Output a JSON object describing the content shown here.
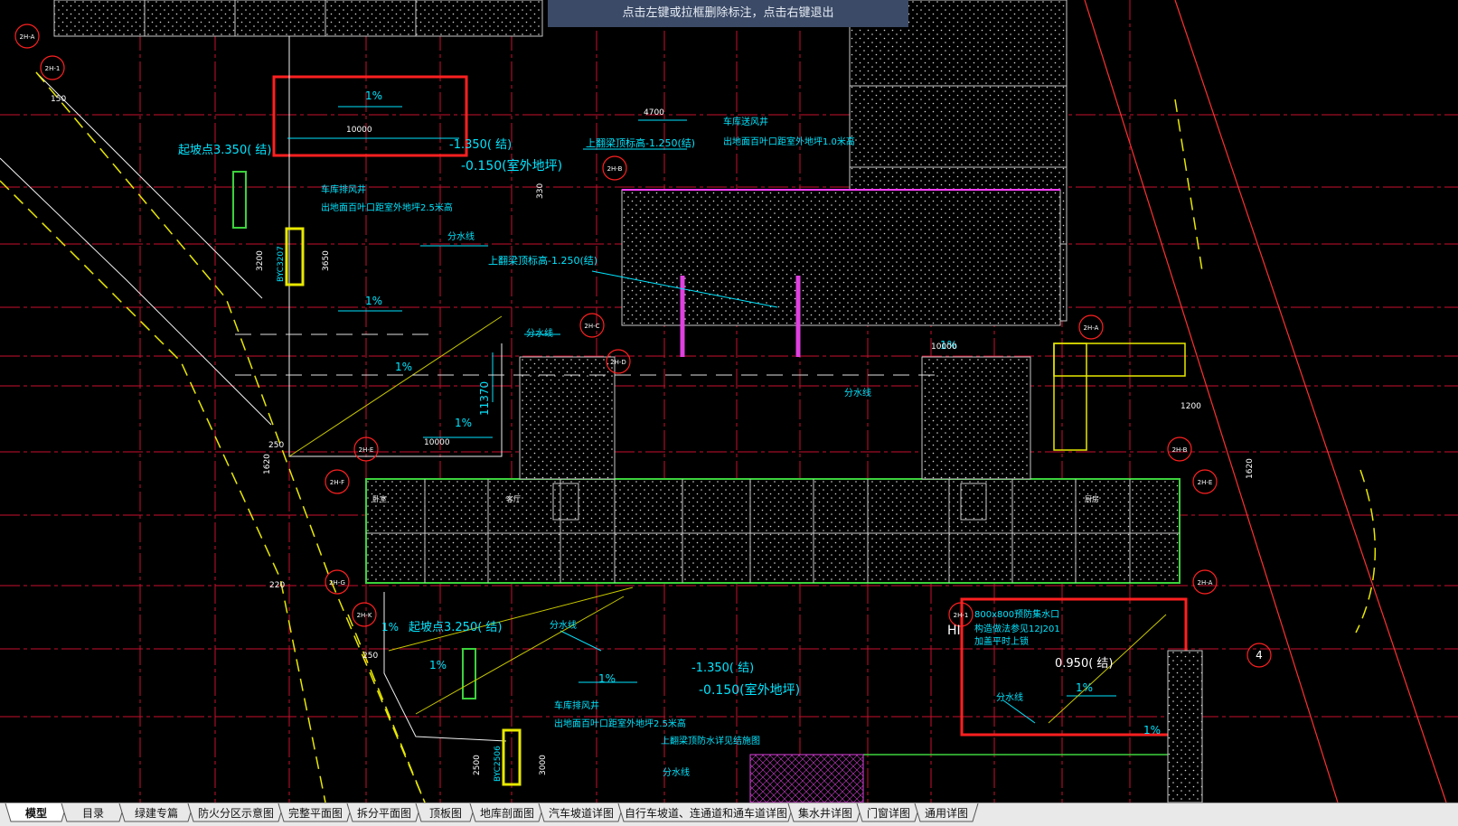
{
  "app": {
    "mode": "CAD drawing viewer"
  },
  "tooltip": {
    "text": "点击左键或拉框删除标注，点击右键退出"
  },
  "colors": {
    "background": "#000000",
    "grid_red": "#c8102e",
    "cyan": "#00e5ff",
    "yellow": "#e8e800",
    "green": "#3cd23c",
    "magenta": "#e040e0",
    "white": "#f0f0f0",
    "tooltip_bg": "#3b4a66"
  },
  "tabs": [
    {
      "label": "模型",
      "active": true
    },
    {
      "label": "目录",
      "active": false
    },
    {
      "label": "绿建专篇",
      "active": false
    },
    {
      "label": "防火分区示意图",
      "active": false
    },
    {
      "label": "完整平面图",
      "active": false
    },
    {
      "label": "拆分平面图",
      "active": false
    },
    {
      "label": "顶板图",
      "active": false
    },
    {
      "label": "地库剖面图",
      "active": false
    },
    {
      "label": "汽车坡道详图",
      "active": false
    },
    {
      "label": "自行车坡道、连通道和通车道详图",
      "active": false
    },
    {
      "label": "集水井详图",
      "active": false
    },
    {
      "label": "门窗详图",
      "active": false
    },
    {
      "label": "通用详图",
      "active": false
    }
  ],
  "annotations": {
    "slope_1pct": "1%",
    "dim_10000": "10000",
    "dim_4700": "4700",
    "dim_11370": "11370",
    "dim_1200": "1200",
    "dim_1620": "1620",
    "dim_3200": "3200",
    "dim_3650": "3650",
    "dim_3000": "3000",
    "dim_2500": "2500",
    "dim_330": "330",
    "dim_250": "250",
    "dim_220": "220",
    "dim_150": "150",
    "elev_a": "-1.350(  结)",
    "elev_b": "-0.150(室外地坪)",
    "elev_c": "-1.350(  结)",
    "elev_d": "-0.150(室外地坪)",
    "elev_e": "0.950(  结)",
    "slope_start_a": "起坡点3.350(  结)",
    "slope_start_b": "起坡点3.250(  结)",
    "exhaust_a_title": "车库排风井",
    "exhaust_a_note": "出地面百叶口距室外地坪2.5米高",
    "exhaust_b_title": "车库排风井",
    "exhaust_b_note": "出地面百叶口距室外地坪2.5米高",
    "intake_title": "车库送风井",
    "intake_note": "出地面百叶口距室外地坪1.0米高",
    "beam_a": "上翻梁顶标高-1.250(结)",
    "beam_b": "上翻梁顶标高-1.250(结)",
    "beam_c": "上翻梁顶防水详见结施图",
    "divide_a": "分水线",
    "divide_b": "分水线",
    "divide_c": "分水线",
    "divide_d": "分水线",
    "divide_e": "分水线",
    "divide_f": "分水线",
    "drain_a": "800x800预防集水口",
    "drain_b": "构造做法参见12J201",
    "drain_c": "加盖平时上锁",
    "tag_byc_a": "BYC3207",
    "tag_byc_b": "BYC2506",
    "room_a": "卧室",
    "room_b": "客厅",
    "room_c": "厨房",
    "hi_label": "HI"
  },
  "axis_bubbles": [
    "2H-A",
    "2H-1",
    "2H-B",
    "2H-C",
    "2H-D",
    "2H-E",
    "2H-F",
    "2H-G",
    "2H-K",
    "2H-A",
    "2H-B",
    "2H-E",
    "2H-A",
    "2H-1",
    "4"
  ]
}
